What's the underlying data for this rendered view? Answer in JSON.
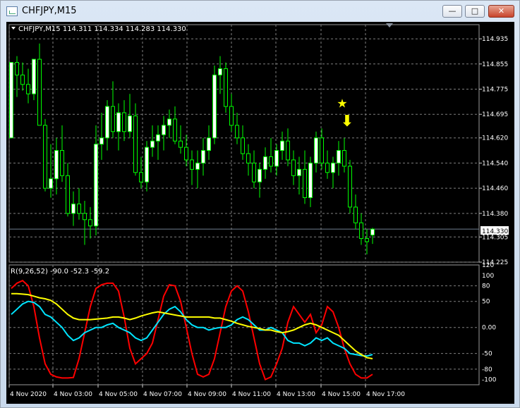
{
  "window": {
    "title": "CHFJPY,M15",
    "minimize_glyph": "—",
    "maximize_glyph": "□",
    "close_glyph": "✕"
  },
  "main_panel": {
    "info": "CHFJPY,M15  114.311 114.334 114.283 114.330",
    "current_price": "114.330",
    "price_labels": [
      "114.935",
      "114.855",
      "114.775",
      "114.695",
      "114.620",
      "114.540",
      "114.460",
      "114.380",
      "114.305",
      "114.225"
    ],
    "star_glyph": "★",
    "arrow_glyph": "⬇"
  },
  "sub_panel": {
    "info": "R(9,26,52) -90.0 -52.3 -59.2",
    "labels": [
      "120",
      "100",
      "80",
      "50",
      "0.00",
      "-50",
      "-80",
      "-100"
    ]
  },
  "time_axis": [
    "4 Nov 2020",
    "4 Nov 03:00",
    "4 Nov 05:00",
    "4 Nov 07:00",
    "4 Nov 09:00",
    "4 Nov 11:00",
    "4 Nov 13:00",
    "4 Nov 15:00",
    "4 Nov 17:00"
  ],
  "colors": {
    "background": "#000000",
    "grid": "#7f7f7f",
    "candle": "#00ff00",
    "bull_fill": "#ffffff",
    "fast_line": "#ff0000",
    "mid_line": "#00e5ff",
    "slow_line": "#ffff00",
    "marker": "#ffff00"
  },
  "chart_data": [
    {
      "type": "candlestick",
      "title": "CHFJPY,M15",
      "timeframe": "M15",
      "last_bar": {
        "open": 114.311,
        "high": 114.334,
        "low": 114.283,
        "close": 114.33
      },
      "ylim": [
        114.225,
        114.98
      ],
      "grid": true,
      "x_labels": [
        "4 Nov 2020",
        "4 Nov 03:00",
        "4 Nov 05:00",
        "4 Nov 07:00",
        "4 Nov 09:00",
        "4 Nov 11:00",
        "4 Nov 13:00",
        "4 Nov 15:00",
        "4 Nov 17:00"
      ],
      "ohlc": [
        [
          114.62,
          114.86,
          114.62,
          114.86
        ],
        [
          114.86,
          114.88,
          114.75,
          114.82
        ],
        [
          114.82,
          114.86,
          114.77,
          114.79
        ],
        [
          114.79,
          114.84,
          114.73,
          114.76
        ],
        [
          114.76,
          114.87,
          114.74,
          114.87
        ],
        [
          114.87,
          114.92,
          114.66,
          114.66
        ],
        [
          114.66,
          114.68,
          114.45,
          114.46
        ],
        [
          114.46,
          114.6,
          114.43,
          114.49
        ],
        [
          114.49,
          114.62,
          114.44,
          114.58
        ],
        [
          114.58,
          114.66,
          114.48,
          114.5
        ],
        [
          114.5,
          114.54,
          114.37,
          114.38
        ],
        [
          114.38,
          114.45,
          114.34,
          114.41
        ],
        [
          114.41,
          114.46,
          114.36,
          114.38
        ],
        [
          114.38,
          114.42,
          114.28,
          114.36
        ],
        [
          114.36,
          114.4,
          114.3,
          114.34
        ],
        [
          114.34,
          114.66,
          114.31,
          114.6
        ],
        [
          114.6,
          114.7,
          114.55,
          114.62
        ],
        [
          114.62,
          114.74,
          114.58,
          114.72
        ],
        [
          114.72,
          114.8,
          114.62,
          114.64
        ],
        [
          114.64,
          114.73,
          114.58,
          114.7
        ],
        [
          114.7,
          114.74,
          114.61,
          114.64
        ],
        [
          114.64,
          114.76,
          114.62,
          114.69
        ],
        [
          114.69,
          114.73,
          114.5,
          114.51
        ],
        [
          114.51,
          114.56,
          114.46,
          114.48
        ],
        [
          114.48,
          114.61,
          114.45,
          114.59
        ],
        [
          114.59,
          114.66,
          114.56,
          114.61
        ],
        [
          114.61,
          114.66,
          114.55,
          114.63
        ],
        [
          114.63,
          114.69,
          114.58,
          114.66
        ],
        [
          114.66,
          114.71,
          114.62,
          114.68
        ],
        [
          114.68,
          114.72,
          114.6,
          114.61
        ],
        [
          114.61,
          114.66,
          114.57,
          114.59
        ],
        [
          114.59,
          114.63,
          114.53,
          114.55
        ],
        [
          114.55,
          114.58,
          114.47,
          114.52
        ],
        [
          114.52,
          114.58,
          114.46,
          114.54
        ],
        [
          114.54,
          114.62,
          114.5,
          114.58
        ],
        [
          114.58,
          114.66,
          114.55,
          114.62
        ],
        [
          114.62,
          114.85,
          114.6,
          114.82
        ],
        [
          114.82,
          114.88,
          114.76,
          114.84
        ],
        [
          114.84,
          114.86,
          114.7,
          114.72
        ],
        [
          114.72,
          114.76,
          114.64,
          114.66
        ],
        [
          114.66,
          114.7,
          114.6,
          114.62
        ],
        [
          114.62,
          114.66,
          114.55,
          114.57
        ],
        [
          114.57,
          114.6,
          114.5,
          114.54
        ],
        [
          114.54,
          114.58,
          114.46,
          114.48
        ],
        [
          114.48,
          114.54,
          114.43,
          114.52
        ],
        [
          114.52,
          114.59,
          114.49,
          114.56
        ],
        [
          114.56,
          114.62,
          114.51,
          114.53
        ],
        [
          114.53,
          114.6,
          114.5,
          114.58
        ],
        [
          114.58,
          114.64,
          114.55,
          114.61
        ],
        [
          114.61,
          114.65,
          114.53,
          114.55
        ],
        [
          114.55,
          114.58,
          114.47,
          114.5
        ],
        [
          114.5,
          114.56,
          114.44,
          114.52
        ],
        [
          114.52,
          114.58,
          114.41,
          114.43
        ],
        [
          114.43,
          114.56,
          114.4,
          114.54
        ],
        [
          114.54,
          114.64,
          114.51,
          114.62
        ],
        [
          114.62,
          114.65,
          114.52,
          114.54
        ],
        [
          114.54,
          114.58,
          114.49,
          114.51
        ],
        [
          114.51,
          114.56,
          114.46,
          114.54
        ],
        [
          114.54,
          114.61,
          114.5,
          114.58
        ],
        [
          114.58,
          114.62,
          114.51,
          114.53
        ],
        [
          114.53,
          114.55,
          114.38,
          114.4
        ],
        [
          114.4,
          114.44,
          114.33,
          114.35
        ],
        [
          114.35,
          114.38,
          114.28,
          114.3
        ],
        [
          114.3,
          114.33,
          114.25,
          114.29
        ],
        [
          114.311,
          114.334,
          114.283,
          114.33
        ]
      ],
      "annotations": [
        {
          "type": "star",
          "price": 114.73
        },
        {
          "type": "down-arrow",
          "price": 114.675
        }
      ]
    },
    {
      "type": "line",
      "title": "R(9,26,52)",
      "last_values": [
        -90.0,
        -52.3,
        -59.2
      ],
      "ylim": [
        -110,
        120
      ],
      "y_labels": [
        "120",
        "100",
        "80",
        "50",
        "0.00",
        "-50",
        "-80",
        "-100"
      ],
      "grid": true,
      "series": [
        {
          "color": "#ff0000",
          "values": [
            75,
            85,
            90,
            80,
            40,
            -20,
            -70,
            -90,
            -95,
            -97,
            -97,
            -96,
            -60,
            -10,
            40,
            75,
            82,
            85,
            85,
            70,
            20,
            -40,
            -70,
            -60,
            -50,
            -30,
            15,
            60,
            82,
            80,
            50,
            0,
            -50,
            -90,
            -95,
            -90,
            -60,
            -10,
            40,
            70,
            80,
            70,
            30,
            -20,
            -70,
            -100,
            -95,
            -70,
            -40,
            10,
            40,
            25,
            10,
            25,
            -10,
            5,
            40,
            30,
            0,
            -40,
            -70,
            -90,
            -97,
            -97,
            -90
          ]
        },
        {
          "color": "#00e5ff",
          "values": [
            25,
            35,
            45,
            50,
            48,
            40,
            25,
            20,
            10,
            0,
            -15,
            -25,
            -20,
            -10,
            -5,
            0,
            0,
            5,
            8,
            0,
            -5,
            -10,
            -20,
            -25,
            -20,
            -5,
            10,
            25,
            35,
            40,
            30,
            15,
            5,
            0,
            0,
            -5,
            -2,
            0,
            0,
            5,
            15,
            20,
            15,
            5,
            -5,
            -5,
            0,
            -5,
            -10,
            -25,
            -30,
            -30,
            -35,
            -30,
            -20,
            -25,
            -20,
            -30,
            -35,
            -40,
            -50,
            -52,
            -54,
            -55,
            -52
          ]
        },
        {
          "color": "#ffff00",
          "values": [
            65,
            65,
            64,
            63,
            60,
            57,
            55,
            52,
            45,
            35,
            25,
            18,
            15,
            15,
            15,
            16,
            17,
            18,
            20,
            20,
            18,
            15,
            18,
            22,
            25,
            28,
            30,
            28,
            26,
            24,
            22,
            20,
            20,
            20,
            20,
            20,
            18,
            18,
            15,
            12,
            8,
            5,
            2,
            0,
            -2,
            -5,
            -5,
            -8,
            -10,
            -8,
            -5,
            0,
            5,
            8,
            5,
            0,
            -5,
            -10,
            -15,
            -25,
            -35,
            -45,
            -52,
            -58,
            -60
          ]
        }
      ]
    }
  ]
}
